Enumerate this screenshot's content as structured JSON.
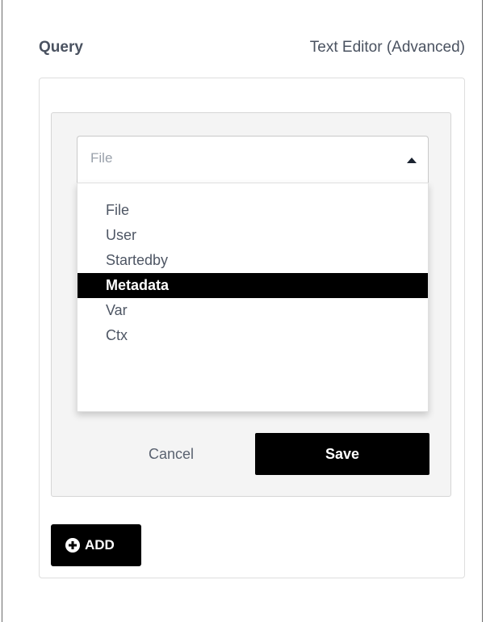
{
  "header": {
    "query_label": "Query",
    "mode_link": "Text Editor (Advanced)"
  },
  "rule": {
    "select": {
      "value": "File",
      "arrow_icon": "caret-up-icon"
    },
    "dropdown": {
      "options": [
        "File",
        "User",
        "Startedby",
        "Metadata",
        "Var",
        "Ctx"
      ],
      "highlighted": "Metadata"
    },
    "cancel_label": "Cancel",
    "save_label": "Save"
  },
  "add_button": {
    "icon": "plus-circle-icon",
    "label": "ADD"
  },
  "colors": {
    "primary_button": "#000000",
    "text": "#4a5260",
    "placeholder": "#9aa1ab"
  }
}
